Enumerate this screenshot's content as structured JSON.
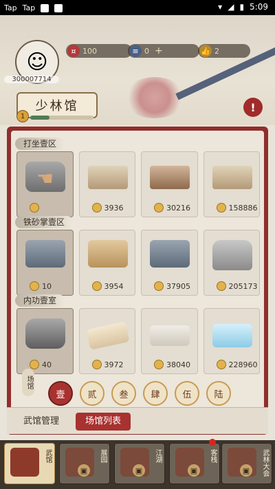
{
  "status": {
    "left_apps": [
      "Tap",
      "Tap"
    ],
    "time": "5:09"
  },
  "header": {
    "uid": "300007714",
    "resources": [
      {
        "icon": "coin-icon",
        "value": "100"
      },
      {
        "icon": "scroll-icon",
        "value": "0"
      },
      {
        "icon": "thumb-icon",
        "value": "2"
      }
    ],
    "plus": "+"
  },
  "title": {
    "text": "少林馆",
    "level": "1",
    "progress": 0.3
  },
  "alert_icon": "!",
  "sections": [
    {
      "label": "打坐壹区",
      "items": [
        {
          "price": ""
        },
        {
          "price": "3936"
        },
        {
          "price": "30216"
        },
        {
          "price": "158886"
        }
      ]
    },
    {
      "label": "铁砂掌壹区",
      "items": [
        {
          "price": "10"
        },
        {
          "price": "3954"
        },
        {
          "price": "37905"
        },
        {
          "price": "205173"
        }
      ]
    },
    {
      "label": "内功壹室",
      "items": [
        {
          "price": "40"
        },
        {
          "price": "3972"
        },
        {
          "price": "38040"
        },
        {
          "price": "228960"
        }
      ]
    }
  ],
  "levels": {
    "label": "场馆",
    "items": [
      "壹",
      "贰",
      "叁",
      "肆",
      "伍",
      "陆"
    ]
  },
  "subtabs": [
    "武馆管理",
    "场馆列表"
  ],
  "bottom_tabs": [
    "武馆",
    "展园",
    "江湖",
    "客栈",
    "武林大会"
  ]
}
